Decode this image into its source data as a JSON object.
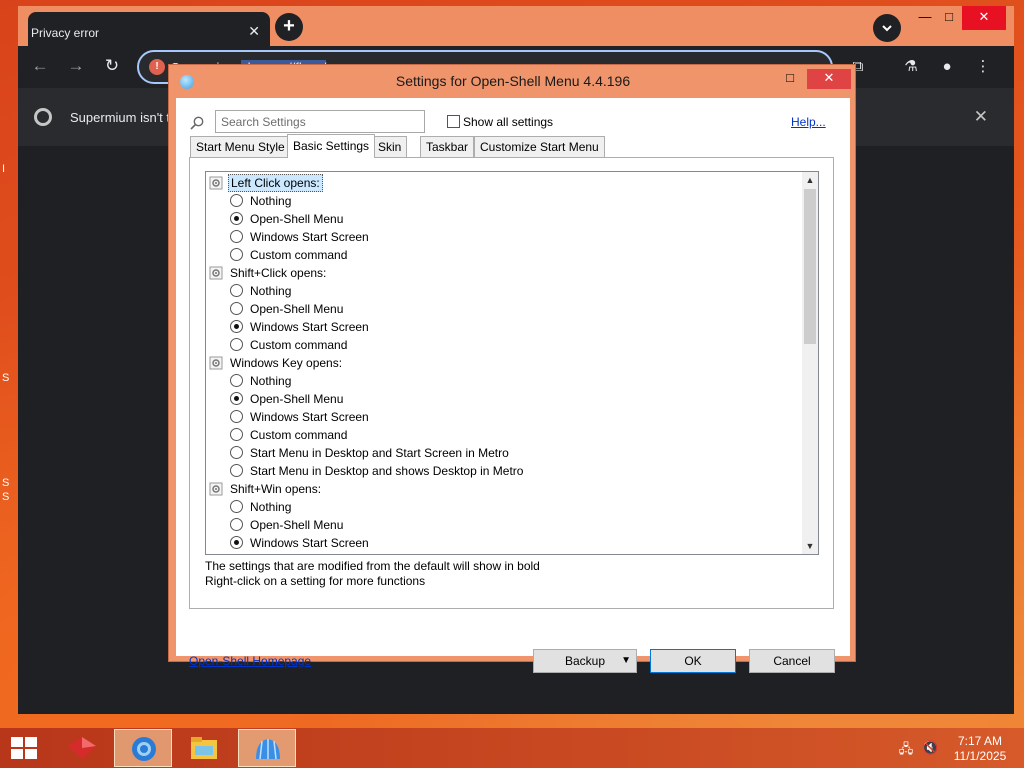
{
  "browser": {
    "tab_title": "Privacy error",
    "tab_close": "✕",
    "new_tab": "+",
    "omnibox_prefix": "Su",
    "omnibox_text": "permium",
    "omnibox_selected": "chrome://flags/",
    "infobar_text": "Supermium isn't t",
    "minimize": "—",
    "maximize": "□",
    "close": "✕"
  },
  "desktop": {
    "frag_1": "I",
    "frag_2": "S",
    "frag_3": "S",
    "frag_4": "S"
  },
  "dialog": {
    "title": "Settings for Open-Shell Menu 4.4.196",
    "search_placeholder": "Search Settings",
    "show_all_label": "Show all settings",
    "help_link": "Help...",
    "tabs": [
      "Start Menu Style",
      "Basic Settings",
      "Skin",
      "Taskbar",
      "Customize Start Menu"
    ],
    "active_tab": "Basic Settings",
    "tree": [
      {
        "kind": "group",
        "label": "Left Click opens:"
      },
      {
        "kind": "option",
        "label": "Nothing",
        "selected": false
      },
      {
        "kind": "option",
        "label": "Open-Shell Menu",
        "selected": true
      },
      {
        "kind": "option",
        "label": "Windows Start Screen",
        "selected": false
      },
      {
        "kind": "option",
        "label": "Custom command",
        "selected": false
      },
      {
        "kind": "group",
        "label": "Shift+Click opens:"
      },
      {
        "kind": "option",
        "label": "Nothing",
        "selected": false
      },
      {
        "kind": "option",
        "label": "Open-Shell Menu",
        "selected": false
      },
      {
        "kind": "option",
        "label": "Windows Start Screen",
        "selected": true
      },
      {
        "kind": "option",
        "label": "Custom command",
        "selected": false
      },
      {
        "kind": "group",
        "label": "Windows Key opens:"
      },
      {
        "kind": "option",
        "label": "Nothing",
        "selected": false
      },
      {
        "kind": "option",
        "label": "Open-Shell Menu",
        "selected": true
      },
      {
        "kind": "option",
        "label": "Windows Start Screen",
        "selected": false
      },
      {
        "kind": "option",
        "label": "Custom command",
        "selected": false
      },
      {
        "kind": "option",
        "label": "Start Menu in Desktop and Start Screen in Metro",
        "selected": false
      },
      {
        "kind": "option",
        "label": "Start Menu in Desktop and shows Desktop in Metro",
        "selected": false
      },
      {
        "kind": "group",
        "label": "Shift+Win opens:"
      },
      {
        "kind": "option",
        "label": "Nothing",
        "selected": false
      },
      {
        "kind": "option",
        "label": "Open-Shell Menu",
        "selected": false
      },
      {
        "kind": "option",
        "label": "Windows Start Screen",
        "selected": true
      }
    ],
    "note_1": "The settings that are modified from the default will show in bold",
    "note_2": "Right-click on a setting for more functions",
    "homepage_link": "Open-Shell Homepage",
    "backup_label": "Backup",
    "ok_label": "OK",
    "cancel_label": "Cancel"
  },
  "taskbar": {
    "time": "7:17 AM",
    "date": "11/1/2025"
  },
  "colors": {
    "desktop_accent": "#e2541f",
    "browser_frame": "#ef8e62",
    "dialog_frame": "#f0956b",
    "close_red": "#e04343",
    "link_blue": "#0033cc"
  }
}
